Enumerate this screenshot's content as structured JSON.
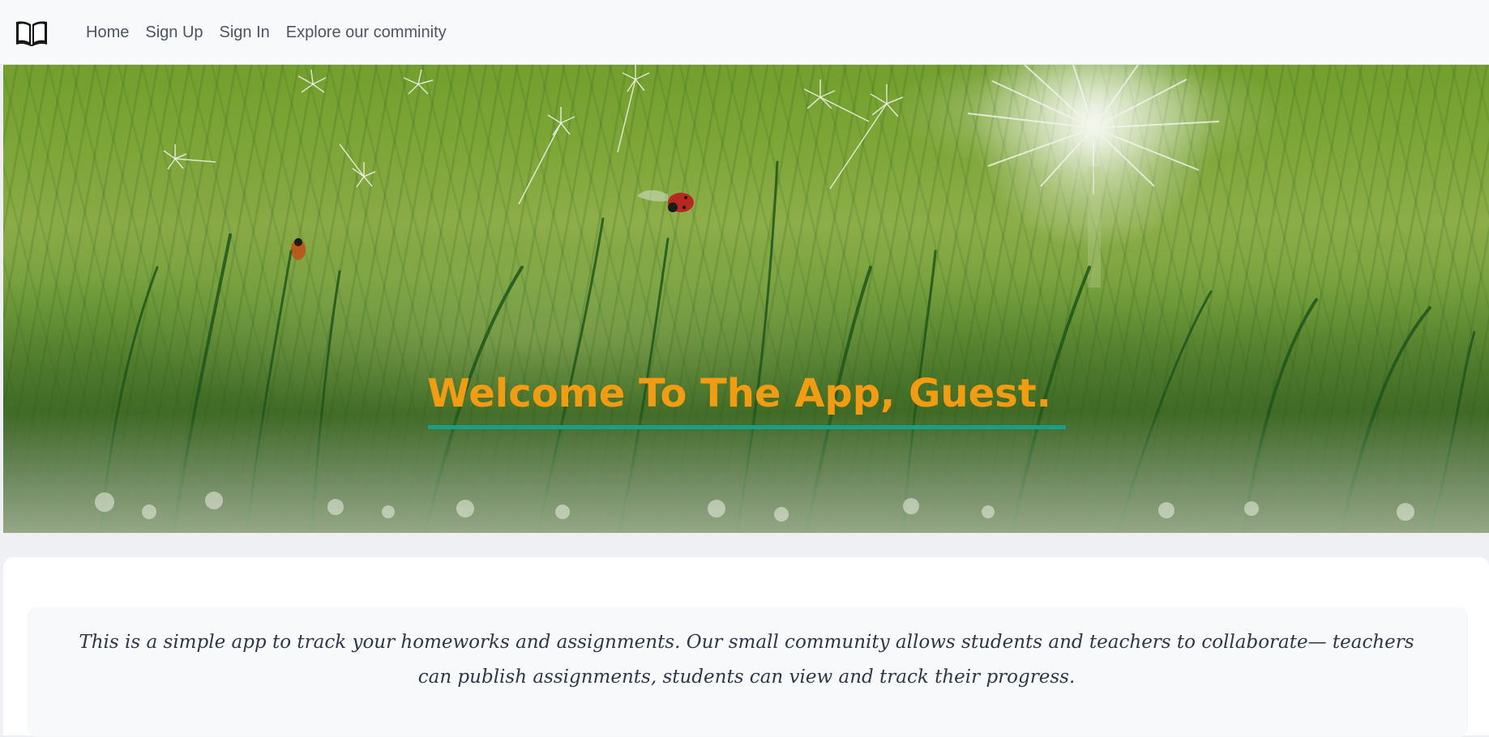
{
  "nav": {
    "brand_icon": "book-open-icon",
    "items": [
      {
        "label": "Home"
      },
      {
        "label": "Sign Up"
      },
      {
        "label": "Sign In"
      },
      {
        "label": "Explore our comminity"
      }
    ]
  },
  "hero": {
    "title": "Welcome To The App, Guest.",
    "title_color": "#f39c12",
    "underline_color": "#16a085"
  },
  "content": {
    "description": "This is a simple app to track your homeworks and assignments. Our small community allows students and teachers to collaborate— teachers can publish assignments, students can view and track their progress."
  }
}
